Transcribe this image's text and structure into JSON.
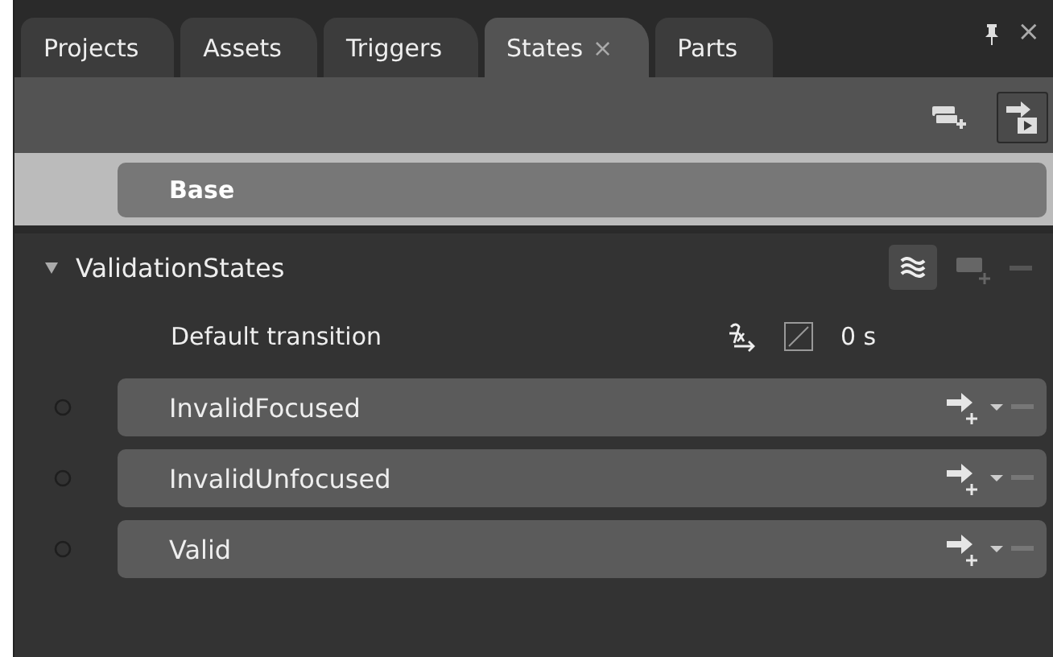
{
  "tabs": [
    {
      "label": "Projects",
      "selected": false
    },
    {
      "label": "Assets",
      "selected": false
    },
    {
      "label": "Triggers",
      "selected": false
    },
    {
      "label": "States",
      "selected": true,
      "close": "×"
    },
    {
      "label": "Parts",
      "selected": false
    }
  ],
  "panel_close": "×",
  "toolbar": {
    "add_group_pressed": false,
    "transition_preview_pressed": true
  },
  "base": {
    "label": "Base",
    "selected": true
  },
  "groups": [
    {
      "name": "ValidationStates",
      "expanded": true,
      "fluid_layout_on": true,
      "default_transition": {
        "label": "Default transition",
        "duration": "0 s"
      },
      "states": [
        {
          "name": "InvalidFocused",
          "selected": false
        },
        {
          "name": "InvalidUnfocused",
          "selected": false
        },
        {
          "name": "Valid",
          "selected": false
        }
      ]
    }
  ]
}
